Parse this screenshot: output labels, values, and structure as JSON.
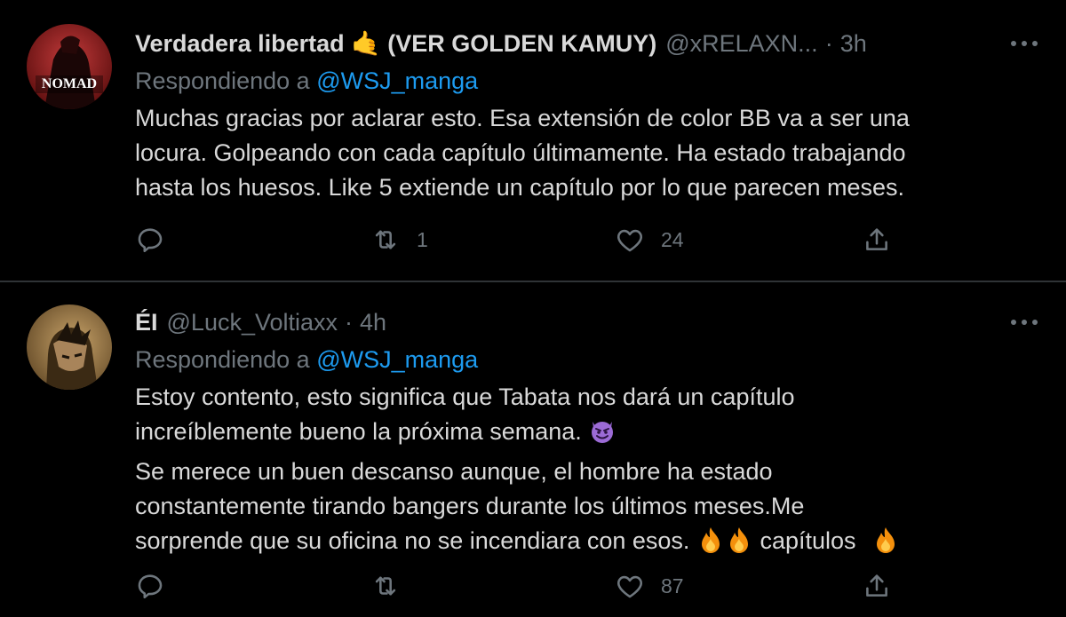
{
  "tweets": [
    {
      "display_name": "Verdadera libertad 🤙 (VER GOLDEN KAMUY)",
      "handle": "@xRELAXN...",
      "dot": "·",
      "time": "3h",
      "replying_prefix": "Respondiendo a",
      "replying_to": "@WSJ_manga",
      "text_lines": [
        "Muchas gracias por aclarar esto. Esa extensión de color BB va a ser una",
        "locura. Golpeando con cada capítulo últimamente. Ha estado trabajando",
        "hasta los huesos. Like 5 extiende un capítulo por lo que parecen meses."
      ],
      "avatar_text": "NOMAD",
      "reply_count": "",
      "retweet_count": "1",
      "like_count": "24"
    },
    {
      "display_name": "ÉI",
      "handle": "@Luck_Voltiaxx",
      "dot": "·",
      "time": "4h",
      "replying_prefix": "Respondiendo a",
      "replying_to": "@WSJ_manga",
      "text_lines": [
        "Estoy contento, esto significa que Tabata nos dará un capítulo",
        "increíblemente bueno la próxima semana.",
        "Se merece un buen descanso aunque, el hombre ha estado",
        "constantemente tirando bangers durante los últimos meses.Me",
        "sorprende que su oficina no se incendiara con esos.",
        "capítulos"
      ],
      "reply_count": "",
      "retweet_count": "",
      "like_count": "87"
    }
  ],
  "icons": {
    "more": "more-icon",
    "reply": "reply-icon",
    "retweet": "retweet-icon",
    "like": "heart-icon",
    "share": "share-icon",
    "emoji_devil": "smiling-devil-emoji",
    "emoji_fire": "fire-emoji"
  },
  "colors": {
    "background": "#000000",
    "text": "#d9d9d9",
    "muted": "#6e767d",
    "link": "#1d9bf0",
    "divider": "#2f3336"
  }
}
